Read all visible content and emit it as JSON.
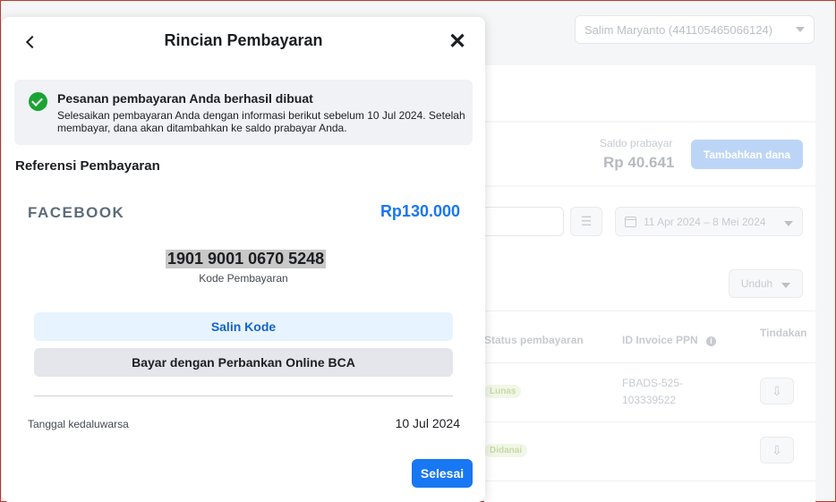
{
  "background": {
    "account_selector": "Salim Maryanto (441105465066124)",
    "balance": {
      "label": "Saldo prabayar",
      "value": "Rp 40.641"
    },
    "add_funds_label": "Tambahkan dana",
    "date_range": "11 Apr 2024 – 8 Mei 2024",
    "download_label": "Unduh",
    "table": {
      "headers": {
        "status": "Status pembayaran",
        "invoice": "ID Invoice PPN",
        "action": "Tindakan"
      },
      "rows": [
        {
          "status": "Lunas",
          "invoice": "FBADS-525-103339522"
        },
        {
          "status": "Didanai",
          "invoice": ""
        }
      ]
    }
  },
  "modal": {
    "title": "Rincian Pembayaran",
    "success": {
      "title": "Pesanan pembayaran Anda berhasil dibuat",
      "text": "Selesaikan pembayaran Anda dengan informasi berikut sebelum 10 Jul 2024. Setelah membayar, dana akan ditambahkan ke saldo prabayar Anda."
    },
    "reference_heading": "Referensi Pembayaran",
    "merchant": "FACEBOOK",
    "amount": "Rp130.000",
    "payment_code": "1901 9001 0670 5248",
    "payment_code_label": "Kode Pembayaran",
    "copy_label": "Salin Kode",
    "bank_label": "Bayar dengan Perbankan Online BCA",
    "expiry_label": "Tanggal kedaluwarsa",
    "expiry_value": "10 Jul 2024",
    "done_label": "Selesai"
  },
  "colors": {
    "primary": "#1877f2",
    "success": "#1aa333",
    "text": "#1c1e21"
  }
}
